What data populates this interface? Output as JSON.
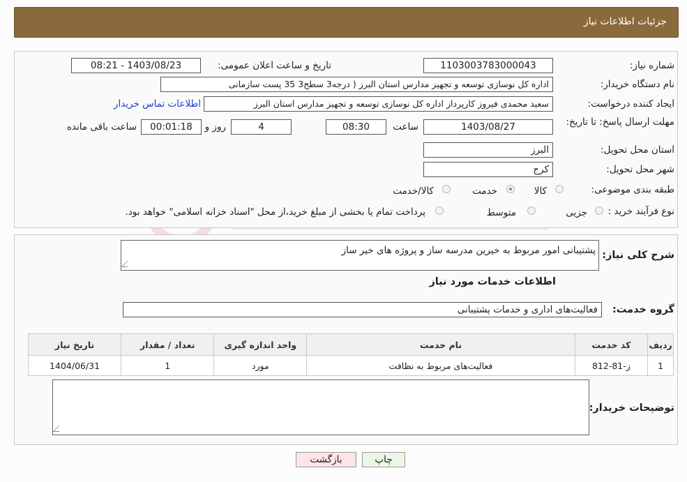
{
  "header": {
    "title": "جزئیات اطلاعات نیاز"
  },
  "form": {
    "need_number_label": "شماره نیاز:",
    "need_number": "1103003783000043",
    "announce_label": "تاریخ و ساعت اعلان عمومی:",
    "announce_value": "1403/08/23 - 08:21",
    "buyer_org_label": "نام دستگاه خریدار:",
    "buyer_org": "اداره کل نوسازی   توسعه و تجهیز مدارس استان البرز ( درجه3  سطح3  35 پست سازمانی",
    "requester_label": "ایجاد کننده درخواست:",
    "requester": "سعید محمدی فیروز کارپرداز اداره کل نوسازی   توسعه و تجهیز مدارس استان البرز",
    "contact_link": "اطلاعات تماس خریدار",
    "deadline_label": "مهلت ارسال پاسخ: تا تاریخ:",
    "deadline_date": "1403/08/27",
    "time_label": "ساعت",
    "deadline_time": "08:30",
    "days_value": "4",
    "days_label": "روز و",
    "remaining_time": "00:01:18",
    "remaining_label": "ساعت باقی مانده",
    "province_label": "استان محل تحویل:",
    "province": "البرز",
    "city_label": "شهر محل تحویل:",
    "city": "کرج",
    "category_label": "طبقه بندی موضوعی:",
    "category_options": [
      "کالا",
      "خدمت",
      "کالا/خدمت"
    ],
    "category_selected": 1,
    "process_label": "نوع فرآیند خرید :",
    "process_options": [
      "جزیی",
      "متوسط"
    ],
    "process_note": "پرداخت تمام یا بخشی از مبلغ خرید،از محل \"اسناد خزانه اسلامی\" خواهد بود."
  },
  "details": {
    "summary_label": "شرح کلی نیاز:",
    "summary": "پشتیبانی امور مربوط به خیرین مدرسه ساز و پروژه های خیر ساز",
    "services_heading": "اطلاعات خدمات مورد نیاز",
    "service_group_label": "گروه خدمت:",
    "service_group": "فعالیت‌های اداری و خدمات پشتیبانی",
    "table": {
      "headers": [
        "ردیف",
        "کد خدمت",
        "نام خدمت",
        "واحد اندازه گیری",
        "تعداد / مقدار",
        "تاریخ نیاز"
      ],
      "rows": [
        [
          "1",
          "ز-81-812",
          "فعالیت‌های مربوط به نظافت",
          "مورد",
          "1",
          "1404/06/31"
        ]
      ]
    },
    "buyer_notes_label": "توضیحات خریدار:"
  },
  "buttons": {
    "print": "چاپ",
    "back": "بازگشت"
  },
  "colors": {
    "header": "#8a6a3c",
    "link": "#1a3fd6",
    "back_button": "#fde4e6",
    "print_button": "#eaf7e6"
  }
}
